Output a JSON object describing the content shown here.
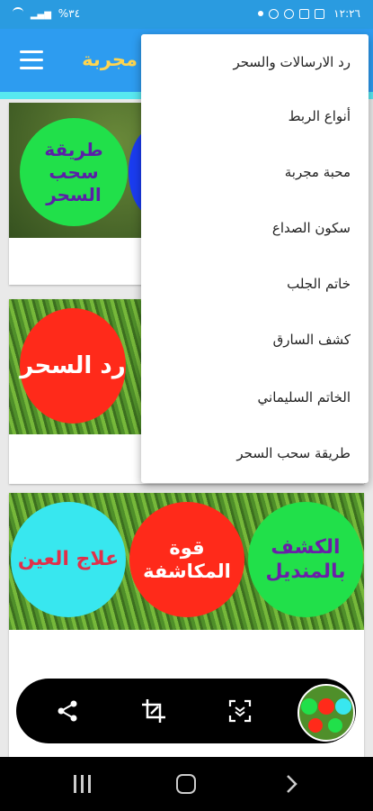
{
  "status_bar": {
    "left_text": "%٣٤",
    "time": "١٢:٢٦"
  },
  "app_bar": {
    "title": "مجربة",
    "menu_icon": "hamburger-icon"
  },
  "cards": [
    {
      "caption": "",
      "circles": [
        {
          "text": "طريقة سحب السحر",
          "bg": "#21e04a",
          "color": "#5b1fa8"
        }
      ]
    },
    {
      "caption": "",
      "circles": [
        {
          "text": "رد السحر",
          "bg": "#ff2a1a",
          "color": "#ffffff"
        }
      ]
    },
    {
      "caption": "",
      "circles": [
        {
          "text": "علاج العين",
          "bg": "#38e7ef",
          "color": "#e0304a"
        },
        {
          "text": "قوة المكاشفة",
          "bg": "#ff2a1a",
          "color": "#ffffff"
        },
        {
          "text": "الكشف بالمنديل",
          "bg": "#21e04a",
          "color": "#6b1fa8"
        }
      ]
    }
  ],
  "menu": {
    "items": [
      {
        "label": "رد الارسالات والسحر"
      },
      {
        "label": "أنواع الربط"
      },
      {
        "label": "محبة مجربة"
      },
      {
        "label": "سكون الصداع"
      },
      {
        "label": "خاتم الجلب"
      },
      {
        "label": "كشف السارق"
      },
      {
        "label": "الخاتم السليماني"
      },
      {
        "label": "طريقة سحب السحر"
      }
    ]
  },
  "screenshot_toolbar": {
    "buttons": [
      {
        "icon": "share-icon"
      },
      {
        "icon": "crop-edit-icon"
      },
      {
        "icon": "scroll-capture-icon"
      },
      {
        "icon": "screenshot-thumbnail"
      }
    ]
  },
  "nav_bar": {
    "buttons": [
      {
        "icon": "recent-apps-icon"
      },
      {
        "icon": "home-icon"
      },
      {
        "icon": "back-icon"
      }
    ]
  },
  "colors": {
    "status_bar": "#2a9be0",
    "app_bar": "#2d9cf0",
    "title": "#ffd54f",
    "accent_strip": "#58e8f0"
  }
}
